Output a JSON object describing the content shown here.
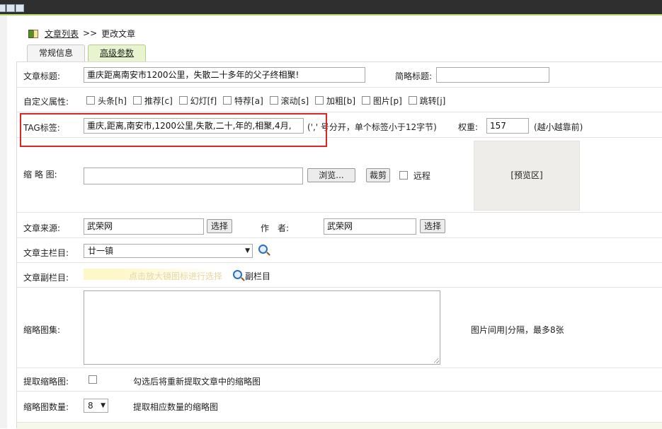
{
  "breadcrumb": {
    "link": "文章列表",
    "sep": ">>",
    "current": "更改文章"
  },
  "tabs": [
    {
      "label": "常规信息"
    },
    {
      "label": "高级参数"
    }
  ],
  "fields": {
    "title": {
      "label": "文章标题:",
      "value": "重庆距离南安市1200公里，失散二十多年的父子终相聚!"
    },
    "short_title": {
      "label": "简略标题:",
      "value": ""
    },
    "attrs": {
      "label": "自定义属性:",
      "items": [
        "头条[h]",
        "推荐[c]",
        "幻灯[f]",
        "特荐[a]",
        "滚动[s]",
        "加粗[b]",
        "图片[p]",
        "跳转[j]"
      ]
    },
    "tag": {
      "label": "TAG标签:",
      "value": "重庆,距离,南安市,1200公里,失散,二十,年的,相聚,4月,",
      "note": "(',' 号分开，单个标签小于12字节)"
    },
    "weight": {
      "label": "权重:",
      "value": "157",
      "note": "(越小越靠前)"
    },
    "thumb": {
      "label": "缩 略 图:",
      "value": "",
      "browse": "浏览...",
      "crop": "裁剪",
      "remote": "远程",
      "preview": "[预览区]"
    },
    "source": {
      "label": "文章来源:",
      "value": "武荣网",
      "choose": "选择"
    },
    "author": {
      "label": "作　者:",
      "value": "武荣网",
      "choose": "选择"
    },
    "main_column": {
      "label": "文章主栏目:",
      "value": "廿一镇"
    },
    "sub_column": {
      "label": "文章副栏目:",
      "hint": "点击放大镜图标进行选择",
      "link": "副栏目"
    },
    "gallery": {
      "label": "缩略图集:",
      "note": "图片间用|分隔，最多8张"
    },
    "extract": {
      "label": "提取缩略图:",
      "note": "勾选后将重新提取文章中的缩略图"
    },
    "count": {
      "label": "缩略图数量:",
      "value": "8",
      "note": "提取相应数量的缩略图"
    }
  }
}
